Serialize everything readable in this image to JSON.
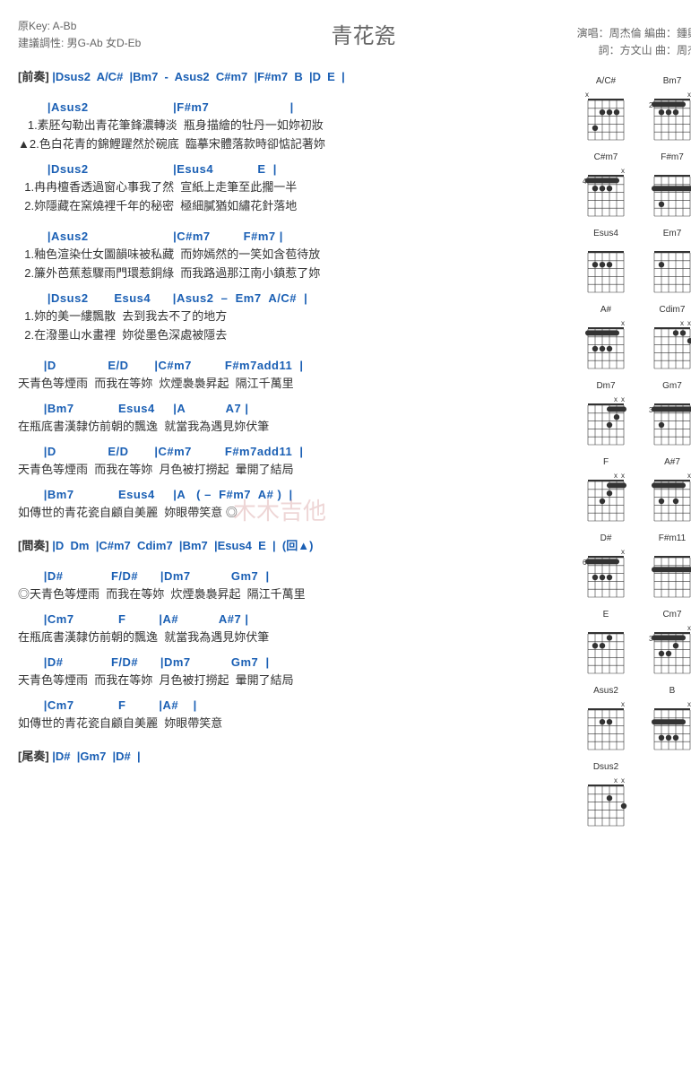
{
  "header": {
    "title": "青花瓷",
    "key_line": "原Key: A-Bb",
    "suggest_line": "建議調性: 男G-Ab 女D-Eb",
    "credit1": "演唱：周杰倫  編曲：鍾興民",
    "credit2": "詞：方文山  曲：周杰倫"
  },
  "sections": {
    "intro_label": "[前奏]",
    "intro_chords": " |Dsus2  A/C#  |Bm7  -  Asus2  C#m7  |F#m7  B  |D  E  |",
    "interlude_label": "[間奏]",
    "interlude_chords": " |D  Dm  |C#m7  Cdim7  |Bm7  |Esus4  E  |  (回▲)",
    "outro_label": "[尾奏]",
    "outro_chords": " |D#  |Gm7  |D#  |"
  },
  "verse1": {
    "c1": "        |Asus2                       |F#m7                      |",
    "l1a": "   1.素胚勾勒出青花筆鋒濃轉淡  瓶身描繪的牡丹一如妳初妝",
    "l1b": "▲2.色白花青的錦鯉躍然於碗底  臨摹宋體落款時卻惦記著妳",
    "c2": "        |Dsus2                       |Esus4            E  |",
    "l2a": "  1.冉冉檀香透過窗心事我了然  宣紙上走筆至此擱一半",
    "l2b": "  2.妳隱藏在窯燒裡千年的秘密  極細膩猶如繡花針落地",
    "c3": "        |Asus2                       |C#m7         F#m7 |",
    "l3a": "  1.釉色渲染仕女圖韻味被私藏  而妳嫣然的一笑如含苞待放",
    "l3b": "  2.簾外芭蕉惹驟雨門環惹銅綠  而我路過那江南小鎮惹了妳",
    "c4": "        |Dsus2       Esus4      |Asus2  –  Em7  A/C#  |",
    "l4a": "  1.妳的美一縷飄散  去到我去不了的地方",
    "l4b": "  2.在潑墨山水畫裡  妳從墨色深處被隱去"
  },
  "chorus1": {
    "c1": "       |D              E/D       |C#m7         F#m7add11  |",
    "l1": "天青色等煙雨  而我在等妳  炊煙裊裊昇起  隔江千萬里",
    "c2": "       |Bm7            Esus4     |A           A7 |",
    "l2": "在瓶底書漢隸仿前朝的飄逸  就當我為遇見妳伏筆",
    "c3": "       |D              E/D       |C#m7         F#m7add11  |",
    "l3": "天青色等煙雨  而我在等妳  月色被打撈起  暈開了結局",
    "c4": "       |Bm7            Esus4     |A   ( –  F#m7  A# )  |",
    "l4": "如傳世的青花瓷自顧自美麗  妳眼帶笑意 ◎"
  },
  "chorus2": {
    "c1": "       |D#             F/D#      |Dm7           Gm7  |",
    "l1": "◎天青色等煙雨  而我在等妳  炊煙裊裊昇起  隔江千萬里",
    "c2": "       |Cm7            F         |A#           A#7 |",
    "l2": "在瓶底書漢隸仿前朝的飄逸  就當我為遇見妳伏筆",
    "c3": "       |D#             F/D#      |Dm7           Gm7  |",
    "l3": "天青色等煙雨  而我在等妳  月色被打撈起  暈開了結局",
    "c4": "       |Cm7            F         |A#    |",
    "l4": "如傳世的青花瓷自顧自美麗  妳眼帶笑意"
  },
  "chord_diagrams": [
    {
      "name": "A/C#",
      "fret": "",
      "mutes": [
        0,
        0,
        0,
        0,
        0,
        1
      ],
      "barre": null,
      "dots": [
        [
          4,
          4
        ],
        [
          3,
          2
        ],
        [
          2,
          2
        ],
        [
          1,
          2
        ]
      ]
    },
    {
      "name": "Bm7",
      "fret": "2",
      "mutes": [
        1,
        0,
        0,
        0,
        0,
        0
      ],
      "barre": [
        2,
        1,
        5
      ],
      "dots": [
        [
          2,
          3
        ],
        [
          3,
          3
        ],
        [
          4,
          3
        ]
      ]
    },
    {
      "name": "C#m7",
      "fret": "4",
      "mutes": [
        1,
        0,
        0,
        0,
        0,
        0
      ],
      "barre": [
        4,
        1,
        5
      ],
      "dots": [
        [
          2,
          5
        ],
        [
          3,
          5
        ],
        [
          4,
          5
        ]
      ]
    },
    {
      "name": "F#m7",
      "fret": "",
      "mutes": [
        0,
        0,
        0,
        0,
        0,
        0
      ],
      "barre": [
        2,
        0,
        5
      ],
      "dots": [
        [
          4,
          4
        ]
      ]
    },
    {
      "name": "Esus4",
      "fret": "",
      "mutes": [
        0,
        0,
        0,
        0,
        0,
        0
      ],
      "barre": null,
      "dots": [
        [
          4,
          2
        ],
        [
          3,
          2
        ],
        [
          2,
          2
        ]
      ]
    },
    {
      "name": "Em7",
      "fret": "",
      "mutes": [
        0,
        0,
        0,
        0,
        0,
        0
      ],
      "barre": null,
      "dots": [
        [
          4,
          2
        ]
      ]
    },
    {
      "name": "A#",
      "fret": "",
      "mutes": [
        1,
        0,
        0,
        0,
        0,
        0
      ],
      "barre": [
        1,
        1,
        5
      ],
      "dots": [
        [
          2,
          3
        ],
        [
          3,
          3
        ],
        [
          4,
          3
        ]
      ]
    },
    {
      "name": "Cdim7",
      "fret": "",
      "mutes": [
        1,
        1,
        0,
        0,
        0,
        0
      ],
      "barre": null,
      "dots": [
        [
          2,
          1
        ],
        [
          1,
          1
        ],
        [
          0,
          2
        ]
      ]
    },
    {
      "name": "Dm7",
      "fret": "",
      "mutes": [
        1,
        1,
        0,
        0,
        0,
        0
      ],
      "barre": [
        1,
        0,
        2
      ],
      "dots": [
        [
          1,
          2
        ],
        [
          2,
          3
        ]
      ]
    },
    {
      "name": "Gm7",
      "fret": "3",
      "mutes": [
        0,
        0,
        0,
        0,
        0,
        0
      ],
      "barre": [
        3,
        0,
        5
      ],
      "dots": [
        [
          4,
          5
        ]
      ]
    },
    {
      "name": "F",
      "fret": "",
      "mutes": [
        1,
        1,
        0,
        0,
        0,
        0
      ],
      "barre": [
        1,
        0,
        2
      ],
      "dots": [
        [
          2,
          2
        ],
        [
          3,
          3
        ]
      ]
    },
    {
      "name": "A#7",
      "fret": "",
      "mutes": [
        1,
        0,
        0,
        0,
        0,
        0
      ],
      "barre": [
        1,
        1,
        5
      ],
      "dots": [
        [
          2,
          3
        ],
        [
          4,
          3
        ]
      ]
    },
    {
      "name": "D#",
      "fret": "6",
      "mutes": [
        1,
        0,
        0,
        0,
        0,
        0
      ],
      "barre": [
        6,
        1,
        5
      ],
      "dots": [
        [
          2,
          8
        ],
        [
          3,
          8
        ],
        [
          4,
          8
        ]
      ]
    },
    {
      "name": "F#m11",
      "fret": "",
      "mutes": [
        0,
        0,
        0,
        0,
        0,
        0
      ],
      "barre": [
        2,
        0,
        5
      ],
      "dots": []
    },
    {
      "name": "E",
      "fret": "",
      "mutes": [
        0,
        0,
        0,
        0,
        0,
        0
      ],
      "barre": null,
      "dots": [
        [
          2,
          1
        ],
        [
          4,
          2
        ],
        [
          3,
          2
        ]
      ]
    },
    {
      "name": "Cm7",
      "fret": "3",
      "mutes": [
        1,
        0,
        0,
        0,
        0,
        0
      ],
      "barre": [
        3,
        1,
        5
      ],
      "dots": [
        [
          2,
          4
        ],
        [
          3,
          5
        ],
        [
          4,
          5
        ]
      ]
    },
    {
      "name": "Asus2",
      "fret": "",
      "mutes": [
        1,
        0,
        0,
        0,
        0,
        0
      ],
      "barre": null,
      "dots": [
        [
          3,
          2
        ],
        [
          2,
          2
        ]
      ]
    },
    {
      "name": "B",
      "fret": "",
      "mutes": [
        1,
        0,
        0,
        0,
        0,
        0
      ],
      "barre": [
        2,
        1,
        5
      ],
      "dots": [
        [
          2,
          4
        ],
        [
          3,
          4
        ],
        [
          4,
          4
        ]
      ]
    },
    {
      "name": "Dsus2",
      "fret": "",
      "mutes": [
        1,
        1,
        0,
        0,
        0,
        0
      ],
      "barre": null,
      "dots": [
        [
          2,
          2
        ],
        [
          0,
          3
        ]
      ]
    }
  ],
  "watermark": "木木吉他"
}
